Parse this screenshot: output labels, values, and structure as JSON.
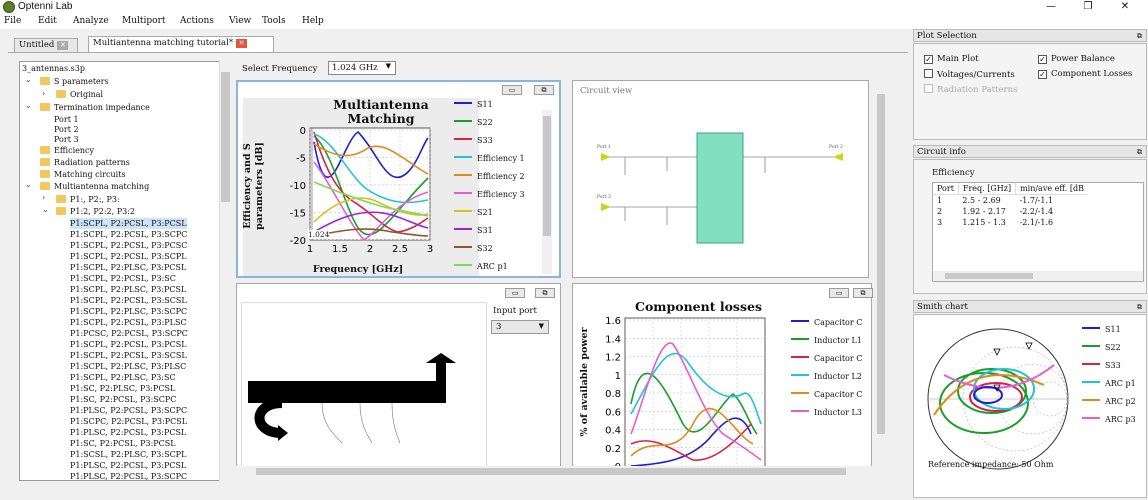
{
  "window": {
    "title": "Optenni Lab",
    "controls": [
      "—",
      "❐",
      "✕"
    ]
  },
  "menu": [
    "File",
    "Edit",
    "Analyze",
    "Multiport",
    "Actions",
    "View",
    "Tools",
    "Help"
  ],
  "tabs": [
    {
      "label": "Untitled"
    },
    {
      "label": "Multiantenna matching tutorial*"
    }
  ],
  "tree": {
    "root": "3_antennas.s3p",
    "s_parameters": "S parameters",
    "original": "Original",
    "termination": "Termination impedance",
    "ports": [
      "Port 1",
      "Port 2",
      "Port 3"
    ],
    "efficiency": "Efficiency",
    "radiation": "Radiation patterns",
    "matching": "Matching circuits",
    "multi": "Multiantenna matching",
    "group1": "P1:, P2:, P3:",
    "group2": "P1:2, P2:2, P3:2",
    "leaves": [
      "P1:SCPL, P2:PCSL, P3:PCSL",
      "P1:SCPL, P2:PCSL, P3:SCPC",
      "P1:SCPL, P2:PCSL, P3:PCSC",
      "P1:SCPL, P2:PCSL, P3:SCPL",
      "P1:SCPL, P2:PLSC, P3:PCSL",
      "P1:SCPL, P2:PCSL, P3:SC",
      "P1:SCPL, P2:PLSC, P3:PCSL",
      "P1:SCPL, P2:PCSL, P3:SCSL",
      "P1:SCPL, P2:PLSC, P3:SCPC",
      "P1:SCPL, P2:PCSL, P3:PLSC",
      "P1:PCSC, P2:PCSL, P3:SCPC",
      "P1:SCPL, P2:PCSL, P3:PCSL",
      "P1:SCPL, P2:PCSL, P3:SCSL",
      "P1:SCPL, P2:PLSC, P3:PLSC",
      "P1:SCPL, P2:PLSC, P3:SC",
      "P1:SC, P2:PLSC, P3:PCSL",
      "P1:SC, P2:PCSL, P3:SCPC",
      "P1:PLSC, P2:PCSL, P3:SCPC",
      "P1:SCPC, P2:PCSL, P3:PCSL",
      "P1:PLSC, P2:PCSL, P3:PCSL",
      "P1:SC, P2:PCSL, P3:PCSL",
      "P1:SCSL, P2:PLSC, P3:SCPL",
      "P1:PLSC, P2:PCSL, P3:PCSL",
      "P1:PLSC, P2:PCSL, P3:SCPC",
      "P1:SCSL, P2:PCSL, P3:PCSL",
      "P1:SCSL, P2:PCSL, P3:SCPL",
      "P1:SCSL, P2:PCSL, P3:PCSL"
    ]
  },
  "freq": {
    "label": "Select Frequency",
    "value": "1.024 GHz"
  },
  "main_plot": {
    "title_line1": "Multiantenna",
    "title_line2": "Matching",
    "ylabel_line1": "Efficiency and S",
    "ylabel_line2": "parameters [dB]",
    "xlabel": "Frequency [GHz]",
    "yticks": [
      "0",
      "-5",
      "-10",
      "-15",
      "-20"
    ],
    "xticks": [
      "1",
      "1.5",
      "2",
      "2.5",
      "3"
    ],
    "marker": "1.024",
    "legend": [
      {
        "name": "S11",
        "color": "#1f1fcf"
      },
      {
        "name": "S22",
        "color": "#1a9e2a"
      },
      {
        "name": "S33",
        "color": "#d6214a"
      },
      {
        "name": "Efficiency 1",
        "color": "#22c3d6"
      },
      {
        "name": "Efficiency 2",
        "color": "#e08a1a"
      },
      {
        "name": "Efficiency 3",
        "color": "#e35fd0"
      },
      {
        "name": "S21",
        "color": "#d4c21f"
      },
      {
        "name": "S31",
        "color": "#a11fd4"
      },
      {
        "name": "S32",
        "color": "#8a5a2a"
      },
      {
        "name": "ARC p1",
        "color": "#7fd957"
      }
    ]
  },
  "circuit": {
    "title": "Circuit view",
    "port1": "Port 1",
    "port2": "Port 2",
    "port3": "Port 3"
  },
  "power_flow": {
    "input_port_label": "Input port",
    "input_port_value": "3"
  },
  "losses": {
    "title": "Component losses",
    "ylabel": "% of available power",
    "yticks": [
      "1.6",
      "1.4",
      "1.2",
      "1",
      "0.8",
      "0.6",
      "0.4",
      "0.2",
      "0"
    ],
    "legend": [
      {
        "name": "Capacitor C",
        "color": "#1f1fcf"
      },
      {
        "name": "Inductor L1",
        "color": "#1a9e2a"
      },
      {
        "name": "Capacitor C",
        "color": "#d6214a"
      },
      {
        "name": "Inductor L2",
        "color": "#22c3d6"
      },
      {
        "name": "Capacitor C",
        "color": "#e08a1a"
      },
      {
        "name": "Inductor L3",
        "color": "#e35fd0"
      }
    ]
  },
  "plot_selection": {
    "title": "Plot Selection",
    "main_plot": "Main Plot",
    "power_balance": "Power Balance",
    "voltages": "Voltages/Currents",
    "losses": "Component Losses",
    "radiation": "Radiation Patterns"
  },
  "circuit_info": {
    "title": "Circuit info",
    "section": "Efficiency",
    "headers": [
      "Port",
      "Freq. [GHz]",
      "min/ave eff. [dB"
    ],
    "rows": [
      [
        "1",
        "2.5 - 2.69",
        "-1.7/-1.1"
      ],
      [
        "2",
        "1.92 - 2.17",
        "-2.2/-1.4"
      ],
      [
        "3",
        "1.215 - 1.3",
        "-2.1/-1.6"
      ]
    ]
  },
  "smith": {
    "title": "Smith chart",
    "legend": [
      {
        "name": "S11",
        "color": "#1f1fcf"
      },
      {
        "name": "S22",
        "color": "#1a9e2a"
      },
      {
        "name": "S33",
        "color": "#d6214a"
      },
      {
        "name": "ARC p1",
        "color": "#22c3d6"
      },
      {
        "name": "ARC p2",
        "color": "#e08a1a"
      },
      {
        "name": "ARC p3",
        "color": "#e35fd0"
      }
    ],
    "reference": "Reference impedance: 50 Ohm"
  }
}
